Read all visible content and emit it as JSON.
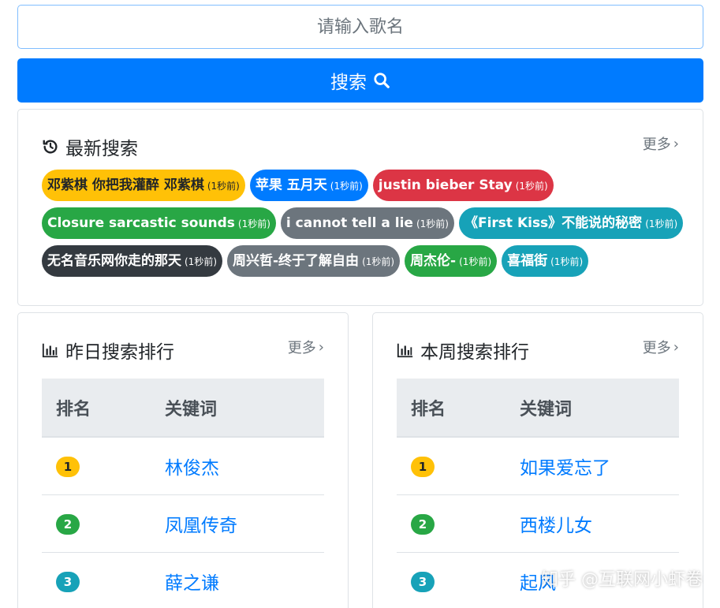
{
  "search": {
    "placeholder": "请输入歌名",
    "button_label": "搜索"
  },
  "recent": {
    "title": "最新搜索",
    "more_label": "更多",
    "rows": [
      [
        {
          "keyword": "邓紫棋 你把我灌醉 邓紫棋",
          "time": "(1秒前)",
          "color": "#ffc107"
        },
        {
          "keyword": "苹果 五月天",
          "time": "(1秒前)",
          "color": "#007bff"
        },
        {
          "keyword": "justin bieber Stay",
          "time": "(1秒前)",
          "color": "#dc3545"
        }
      ],
      [
        {
          "keyword": "Closure sarcastic sounds",
          "time": "(1秒前)",
          "color": "#28a745"
        },
        {
          "keyword": "i cannot tell a lie",
          "time": "(1秒前)",
          "color": "#6c757d"
        },
        {
          "keyword": "《First Kiss》不能说的秘密",
          "time": "(1秒前)",
          "color": "#17a2b8"
        }
      ],
      [
        {
          "keyword": "无名音乐网你走的那天",
          "time": "(1秒前)",
          "color": "#343a40"
        },
        {
          "keyword": "周兴哲-终于了解自由",
          "time": "(1秒前)",
          "color": "#6c757d"
        },
        {
          "keyword": "周杰伦-",
          "time": "(1秒前)",
          "color": "#28a745"
        },
        {
          "keyword": "喜福街",
          "time": "(1秒前)",
          "color": "#17a2b8"
        }
      ]
    ]
  },
  "yesterday": {
    "title": "昨日搜索排行",
    "more_label": "更多",
    "col_rank": "排名",
    "col_keyword": "关键词",
    "rows": [
      {
        "rank": "1",
        "keyword": "林俊杰",
        "color": "#ffc107"
      },
      {
        "rank": "2",
        "keyword": "凤凰传奇",
        "color": "#28a745"
      },
      {
        "rank": "3",
        "keyword": "薛之谦",
        "color": "#17a2b8"
      }
    ]
  },
  "week": {
    "title": "本周搜索排行",
    "more_label": "更多",
    "col_rank": "排名",
    "col_keyword": "关键词",
    "rows": [
      {
        "rank": "1",
        "keyword": "如果爱忘了",
        "color": "#ffc107"
      },
      {
        "rank": "2",
        "keyword": "西楼儿女",
        "color": "#28a745"
      },
      {
        "rank": "3",
        "keyword": "起风",
        "color": "#17a2b8"
      }
    ]
  },
  "watermark": "知乎 @互联网小虾卷"
}
